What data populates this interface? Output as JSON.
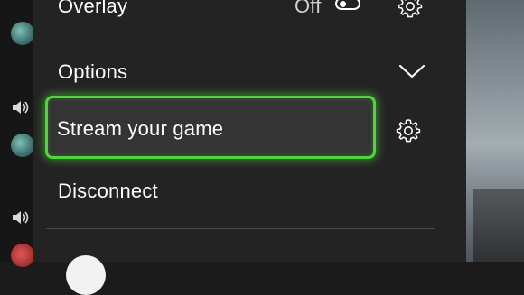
{
  "menu": {
    "overlay_label": "Overlay",
    "overlay_state": "Off",
    "options_label": "Options",
    "stream_label": "Stream your game",
    "disconnect_label": "Disconnect"
  },
  "icons": {
    "settings": "gear-icon",
    "expand": "chevron-down-icon",
    "toggle": "toggle-switch",
    "speaker": "speaker-icon"
  },
  "colors": {
    "focus_accent": "#4fd63a",
    "panel_bg": "#232323",
    "text": "#ffffff"
  }
}
